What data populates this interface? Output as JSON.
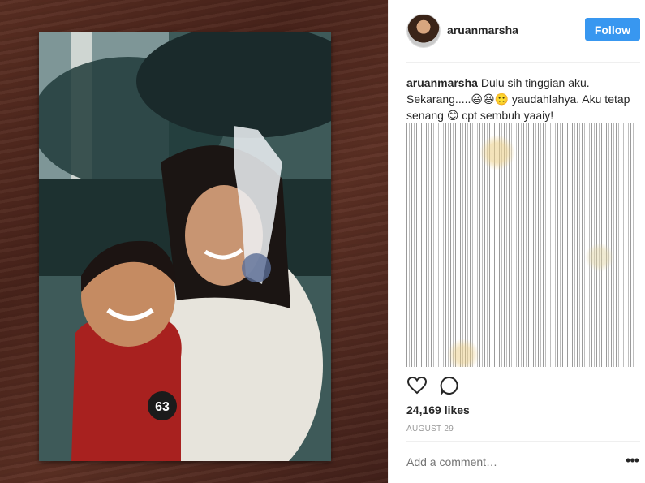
{
  "post": {
    "username": "aruanmarsha",
    "follow_label": "Follow",
    "caption_user": "aruanmarsha",
    "caption_text": "Dulu sih tinggian aku. Sekarang.....😆😆🙁 yaudahlahya. Aku tetap senang 😊 cpt sembuh yaaiy!",
    "likes": "24,169 likes",
    "date": "AUGUST 29",
    "comment_placeholder": "Add a comment…",
    "more_label": "•••"
  },
  "photo": {
    "jersey_number": "63"
  },
  "icons": {
    "like": "heart-icon",
    "comment": "comment-bubble-icon",
    "more": "more-options-icon"
  },
  "colors": {
    "accent": "#3897f0",
    "text": "#262626",
    "muted": "#999999"
  }
}
